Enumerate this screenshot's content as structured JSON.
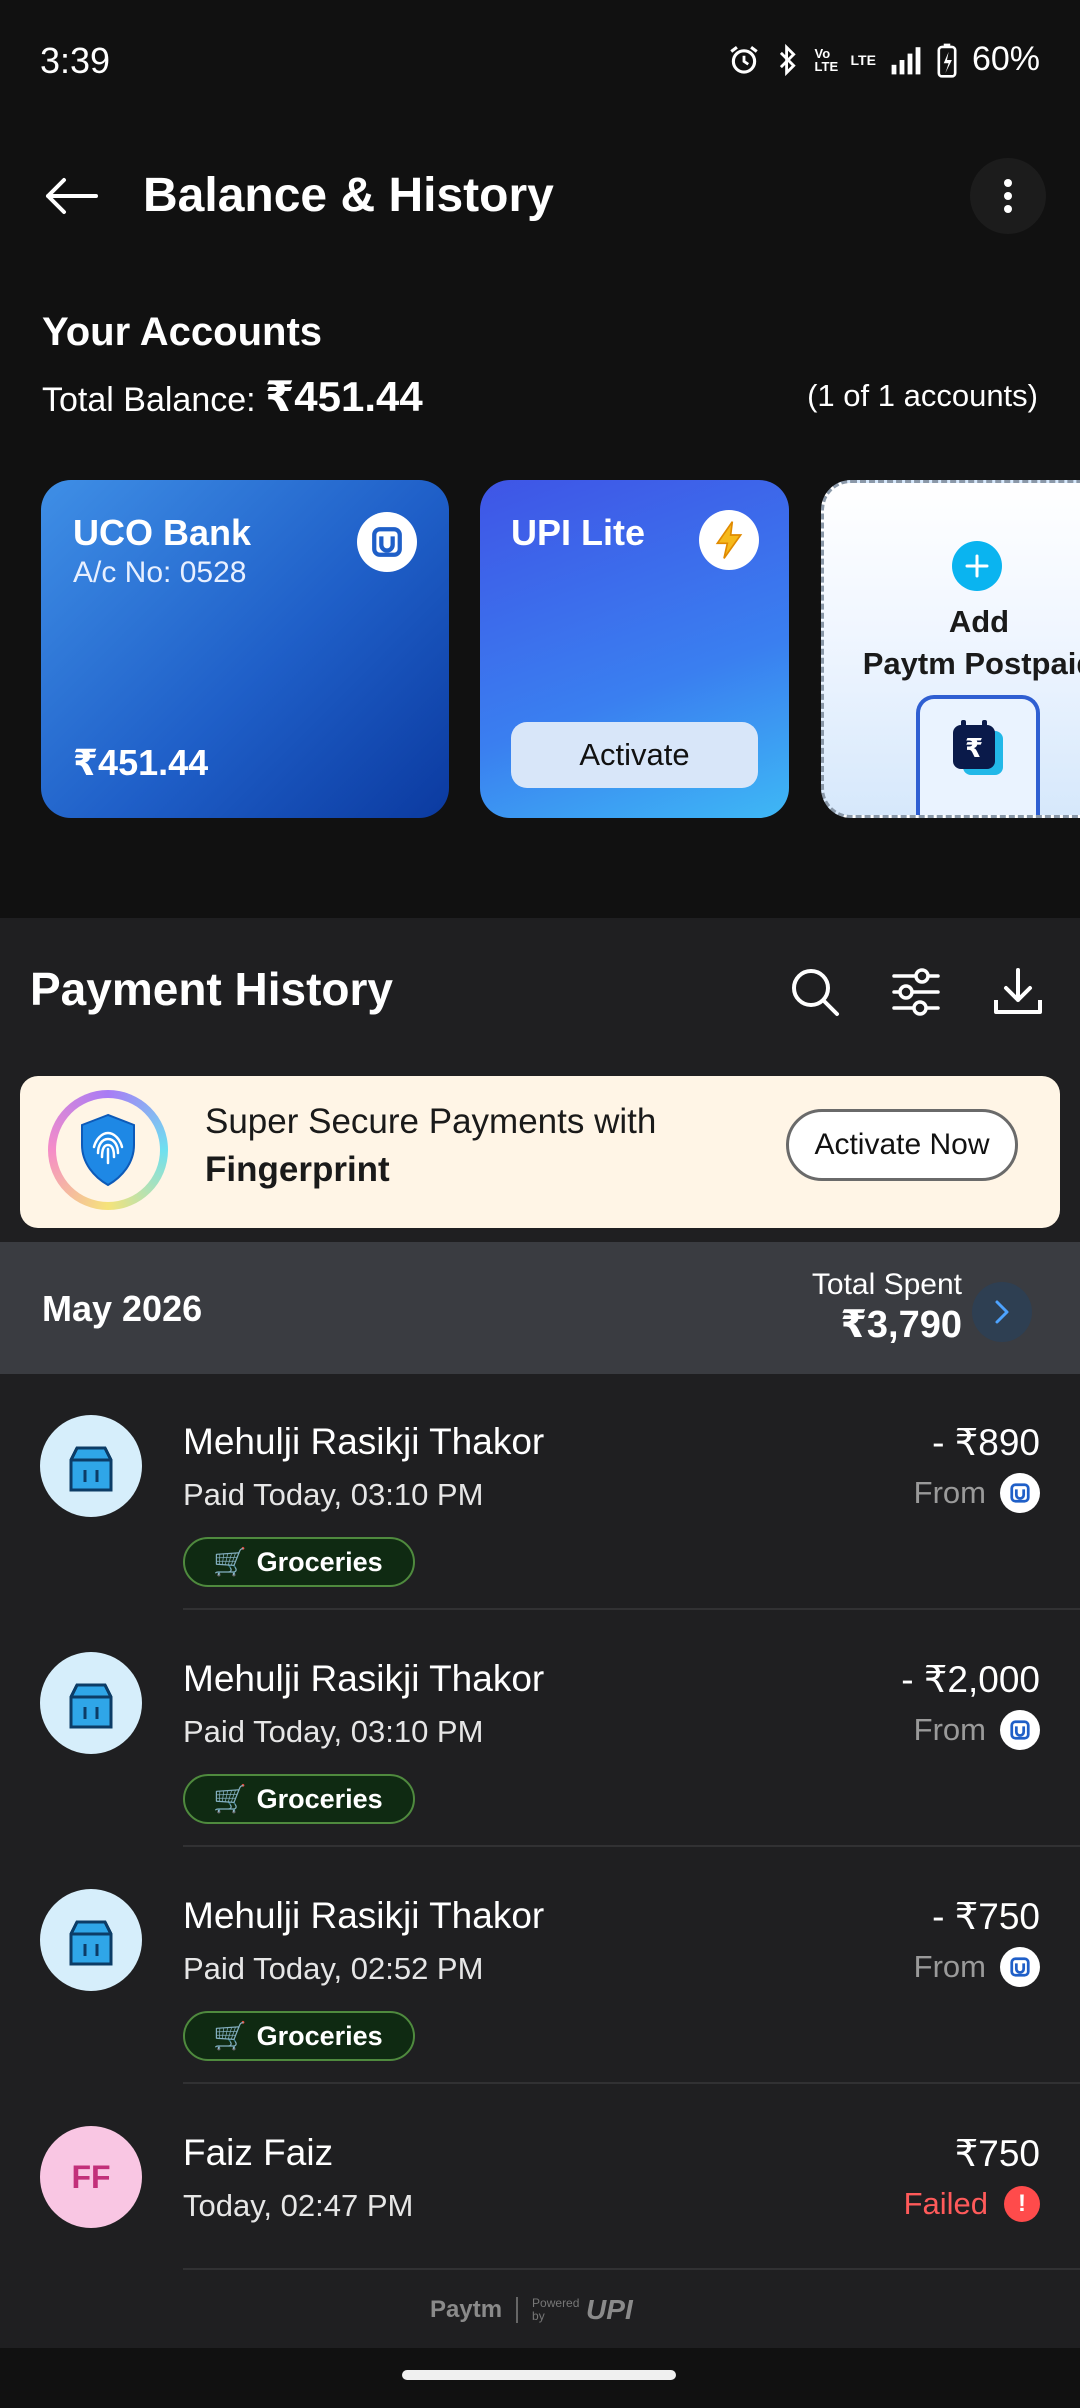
{
  "status_bar": {
    "time": "3:39",
    "battery": "60%",
    "net_volte": "Vo LTE",
    "net_lte": "LTE"
  },
  "header": {
    "title": "Balance & History"
  },
  "accounts": {
    "heading": "Your Accounts",
    "total_label": "Total Balance: ",
    "total_amount": "₹451.44",
    "count_label": "(1 of 1 accounts)",
    "cards": [
      {
        "name": "UCO Bank",
        "acc_no": "A/c No: 0528",
        "balance": "₹451.44"
      },
      {
        "name": "UPI Lite",
        "button": "Activate"
      },
      {
        "line1": "Add",
        "line2": "Paytm Postpaid"
      }
    ]
  },
  "history": {
    "title": "Payment History",
    "promo": {
      "text": "Super Secure Payments with",
      "bold": "Fingerprint",
      "button": "Activate Now"
    },
    "month": {
      "label": "May 2026",
      "spent_label": "Total Spent",
      "spent_amount": "₹3,790"
    },
    "transactions": [
      {
        "name": "Mehulji Rasikji Thakor",
        "time": "Paid Today, 03:10 PM",
        "tag": "Groceries",
        "amount": "- ₹890",
        "from": "From"
      },
      {
        "name": "Mehulji Rasikji Thakor",
        "time": "Paid Today, 03:10 PM",
        "tag": "Groceries",
        "amount": "- ₹2,000",
        "from": "From"
      },
      {
        "name": "Mehulji Rasikji Thakor",
        "time": "Paid Today, 02:52 PM",
        "tag": "Groceries",
        "amount": "- ₹750",
        "from": "From"
      },
      {
        "name": "Faiz Faiz",
        "initials": "FF",
        "time": "Today, 02:47 PM",
        "amount": "₹750",
        "status": "Failed",
        "status_mark": "!"
      }
    ]
  },
  "footer": {
    "brand": "Paytm",
    "powered_by": "Powered by",
    "upi": "UPI"
  },
  "colors": {
    "background": "#111111",
    "panel": "#1f1f21",
    "accent_blue": "#0ab4f0",
    "failed_red": "#ff5a5a",
    "tag_green": "#4f8a3e"
  },
  "icons": [
    "back-arrow-icon",
    "more-vertical-icon",
    "uco-bank-logo-icon",
    "lightning-icon",
    "plus-icon",
    "search-icon",
    "filter-icon",
    "download-icon",
    "fingerprint-shield-icon",
    "chevron-right-icon",
    "grocery-bag-icon",
    "cart-icon",
    "alert-icon"
  ]
}
